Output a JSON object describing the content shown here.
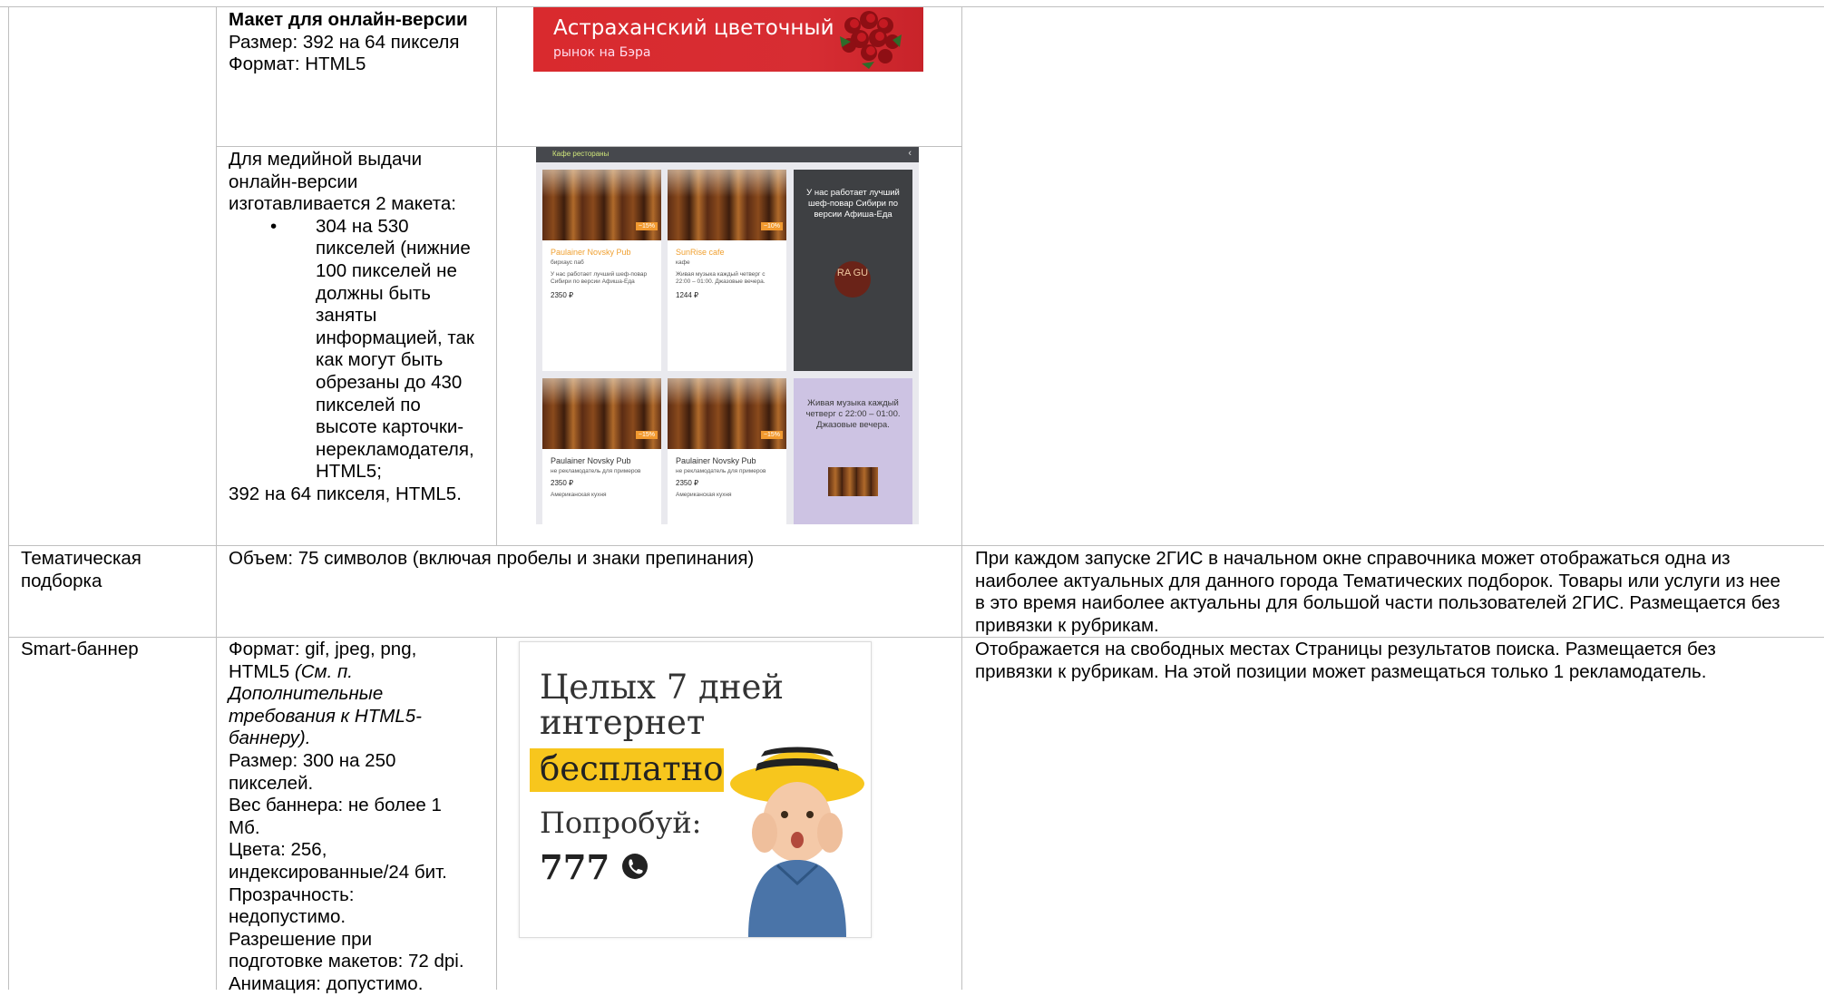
{
  "rows": {
    "online_layout": {
      "title": "Макет для онлайн-версии",
      "size": "Размер: 392 на 64 пикселя",
      "format": "Формат: HTML5",
      "banner": {
        "line1": "Астраханский цветочный",
        "line2": "рынок на Бэра"
      }
    },
    "media": {
      "intro": [
        "Для медийной выдачи",
        "онлайн-версии",
        "изготавливается 2 макета:"
      ],
      "bullet_lines": [
        "304 на 530",
        "пикселей (нижние",
        "100 пикселей не",
        "должны быть",
        "заняты",
        "информацией, так",
        "как могут быть",
        "обрезаны до 430",
        "пикселей по",
        "высоте карточки-",
        "нерекламодателя,",
        "HTML5;"
      ],
      "tail": "392 на 64 пикселя, HTML5.",
      "mock": {
        "topbar": "Кафе рестораны",
        "cards": [
          {
            "name": "Paulainer Novsky Pub",
            "sub": "бирхаус паб",
            "price": "2350 ₽",
            "desc": "У нас работает лучший шеф-повар Сибири по версии Афиша-Еда",
            "badge": "−15%"
          },
          {
            "name": "SunRise cafe",
            "sub": "кафе",
            "price": "1244 ₽",
            "desc": "Живая музыка каждый четверг с 22:00 – 01:00. Джазовые вечера.",
            "badge": "−10%"
          },
          {
            "name": "Paulainer Novsky Pub",
            "sub": "не рекламодатель для примеров",
            "price": "2350 ₽",
            "desc": "Американская кухня",
            "badge": "−15%"
          },
          {
            "name": "Paulainer Novsky Pub",
            "sub": "не рекламодатель для примеров",
            "price": "2350 ₽",
            "desc": "Американская кухня",
            "badge": "−15%"
          }
        ],
        "dark_text": "У нас работает лучший шеф-повар Сибири по версии Афиша-Еда",
        "dark_logo": "RA GU",
        "lilac_text": "Живая музыка каждый четверг с 22:00 – 01:00. Джазовые вечера."
      }
    },
    "thematic": {
      "label": [
        "Тематическая",
        "подборка"
      ],
      "volume": "Объем: 75 символов (включая пробелы и знаки препинания)",
      "description": [
        "При каждом запуске 2ГИС в начальном окне справочника может отображаться одна из",
        "наиболее актуальных для данного города Тематических подборок. Товары или услуги из нее",
        "в это время наиболее актуальны для большой части пользователей 2ГИС. Размещается без",
        "привязки к рубрикам."
      ]
    },
    "smart": {
      "label": "Smart-баннер",
      "format_lines": [
        {
          "text": "Формат: gif, jpeg, png,",
          "style": "normal"
        },
        {
          "text": "HTML5 ",
          "style": "normal",
          "ital": "(См. п."
        },
        {
          "text": "Дополнительные",
          "style": "italic"
        },
        {
          "text": "требования к HTML5-",
          "style": "italic"
        },
        {
          "text": "баннеру).",
          "style": "italic"
        },
        {
          "text": "Размер: 300 на 250",
          "style": "normal"
        },
        {
          "text": "пикселей.",
          "style": "normal"
        },
        {
          "text": "Вес баннера: не более 1",
          "style": "normal"
        },
        {
          "text": "Мб.",
          "style": "normal"
        },
        {
          "text": "Цвета: 256,",
          "style": "normal"
        },
        {
          "text": "индексированные/24 бит.",
          "style": "normal"
        },
        {
          "text": "Прозрачность:",
          "style": "normal"
        },
        {
          "text": "недопустимо.",
          "style": "normal"
        },
        {
          "text": "Разрешение при",
          "style": "normal"
        },
        {
          "text": "подготовке макетов: 72 dpi.",
          "style": "normal"
        },
        {
          "text": "Анимация: допустимо.",
          "style": "normal"
        }
      ],
      "description": [
        "Отображается на свободных местах Страницы результатов поиска. Размещается без",
        "привязки к рубрикам. На этой позиции может размещаться только 1 рекламодатель."
      ],
      "banner": {
        "line1": "Целых 7 дней",
        "line2": "интернет",
        "line3": "бесплатно",
        "line4": "Попробуй:",
        "line5": "777"
      }
    }
  },
  "colors": {
    "grid": "#bfbfbf",
    "red_banner": "#d92a2e",
    "yellow": "#f7c61d"
  }
}
